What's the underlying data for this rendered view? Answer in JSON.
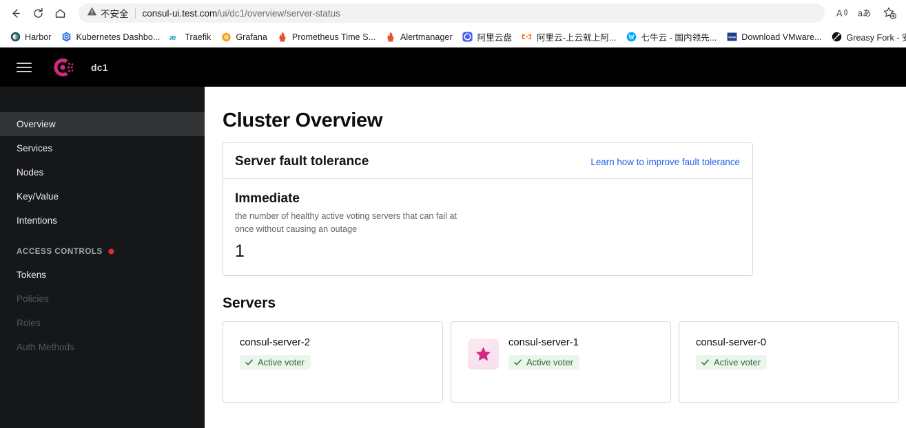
{
  "browser": {
    "nav": {
      "back": "back-arrow",
      "reload": "reload",
      "home": "home"
    },
    "omnibox": {
      "security_label": "不安全",
      "security_icon": "warning-triangle-icon",
      "url_host": "consul-ui.test.com",
      "url_path": "/ui/dc1/overview/server-status"
    },
    "actions": [
      {
        "name": "read-aloud-icon",
        "glyph": "A"
      },
      {
        "name": "translate-icon",
        "glyph": "aあ"
      },
      {
        "name": "add-favorite-icon",
        "glyph": "star-plus"
      }
    ],
    "bookmarks": [
      {
        "label": "Harbor",
        "icon": "harbor-icon",
        "color": "#2b3a42"
      },
      {
        "label": "Kubernetes Dashbo...",
        "icon": "kubernetes-icon",
        "color": "#326ce5"
      },
      {
        "label": "Traefik",
        "icon": "traefik-icon",
        "color": "#24a1c1"
      },
      {
        "label": "Grafana",
        "icon": "grafana-icon",
        "color": "#f6a01a"
      },
      {
        "label": "Prometheus Time S...",
        "icon": "prometheus-icon",
        "color": "#e6522c"
      },
      {
        "label": "Alertmanager",
        "icon": "alertmanager-icon",
        "color": "#e6522c"
      },
      {
        "label": "阿里云盘",
        "icon": "aliyun-drive-icon",
        "color": "#4a5ef5"
      },
      {
        "label": "阿里云-上云就上阿...",
        "icon": "aliyun-icon",
        "color": "#ff6a00"
      },
      {
        "label": "七牛云 - 国内领先...",
        "icon": "qiniu-icon",
        "color": "#00aaff"
      },
      {
        "label": "Download VMware...",
        "icon": "vmware-icon",
        "color": "#1d428a"
      },
      {
        "label": "Greasy Fork - 安全",
        "icon": "greasyfork-icon",
        "color": "#111111"
      }
    ]
  },
  "app": {
    "header": {
      "menu_icon": "hamburger-icon",
      "logo_icon": "consul-logo-icon",
      "datacenter": "dc1"
    },
    "sidebar": {
      "items": [
        {
          "label": "Overview",
          "state": "active"
        },
        {
          "label": "Services",
          "state": "enabled"
        },
        {
          "label": "Nodes",
          "state": "enabled"
        },
        {
          "label": "Key/Value",
          "state": "enabled"
        },
        {
          "label": "Intentions",
          "state": "enabled"
        }
      ],
      "group": {
        "label": "ACCESS CONTROLS",
        "badge": "red-dot"
      },
      "group_items": [
        {
          "label": "Tokens",
          "state": "enabled"
        },
        {
          "label": "Policies",
          "state": "disabled"
        },
        {
          "label": "Roles",
          "state": "disabled"
        },
        {
          "label": "Auth Methods",
          "state": "disabled"
        }
      ]
    },
    "main": {
      "page_title": "Cluster Overview",
      "fault_tolerance": {
        "title": "Server fault tolerance",
        "link": "Learn how to improve fault tolerance",
        "metric_label": "Immediate",
        "metric_description": "the number of healthy active voting servers that can fail at once without causing an outage",
        "metric_value": "1"
      },
      "servers_title": "Servers",
      "servers": [
        {
          "name": "consul-server-2",
          "status": "Active voter",
          "leader": false
        },
        {
          "name": "consul-server-1",
          "status": "Active voter",
          "leader": true
        },
        {
          "name": "consul-server-0",
          "status": "Active voter",
          "leader": false
        }
      ]
    }
  },
  "colors": {
    "brand_pink": "#d62783",
    "link_blue": "#1f5fe8",
    "status_green": "#2a6b36",
    "status_green_bg": "#eaf5ec",
    "sidebar_bg": "#161719",
    "header_bg": "#000000"
  }
}
